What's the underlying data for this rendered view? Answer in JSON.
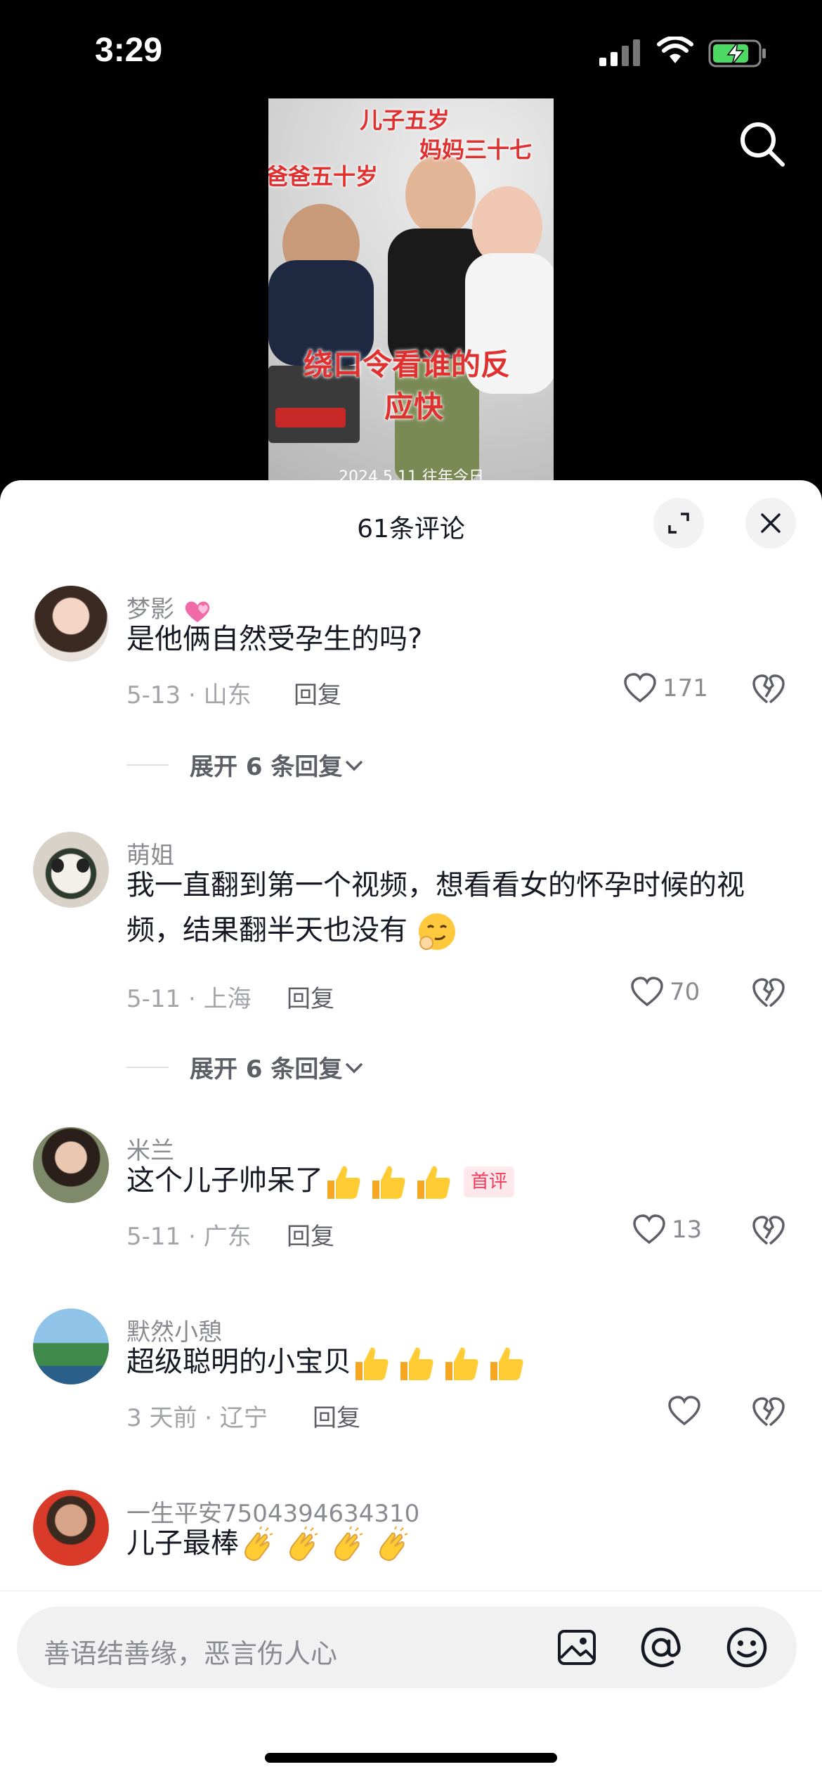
{
  "status_bar": {
    "time": "3:29"
  },
  "video": {
    "captions": [
      "儿子五岁",
      "妈妈三十七",
      "爸爸五十岁",
      "绕口令看谁的反",
      "应快",
      "2024.5.11 往年今日"
    ]
  },
  "sheet": {
    "title": "61条评论"
  },
  "comments": [
    {
      "username": "梦影",
      "text": "是他俩自然受孕生的吗?",
      "date_location": "5-13 · 山东",
      "reply_label": "回复",
      "likes": "171",
      "expand_label": "展开 6 条回复"
    },
    {
      "username": "萌姐",
      "text": "我一直翻到第一个视频，想看看女的怀孕时候的视频，结果翻半天也没有",
      "date_location": "5-11 · 上海",
      "reply_label": "回复",
      "likes": "70",
      "expand_label": "展开 6 条回复"
    },
    {
      "username": "米兰",
      "text": "这个儿子帅呆了",
      "badge": "首评",
      "date_location": "5-11 · 广东",
      "reply_label": "回复",
      "likes": "13"
    },
    {
      "username": "默然小憩",
      "text": "超级聪明的小宝贝",
      "date_location": "3 天前 · 辽宁",
      "reply_label": "回复",
      "likes": ""
    },
    {
      "username": "一生平安7504394634310",
      "text": "儿子最棒"
    }
  ],
  "input": {
    "placeholder": "善语结善缘，恶言伤人心"
  },
  "icons": [
    "signal-icon",
    "wifi-icon",
    "battery-charging-icon",
    "search-icon",
    "expand-icon",
    "close-icon",
    "heart-icon",
    "broken-heart-icon",
    "chevron-down-icon",
    "image-icon",
    "at-icon",
    "emoji-icon"
  ],
  "colors": {
    "accent": "#f23a5c",
    "caption_red": "#e03030"
  }
}
